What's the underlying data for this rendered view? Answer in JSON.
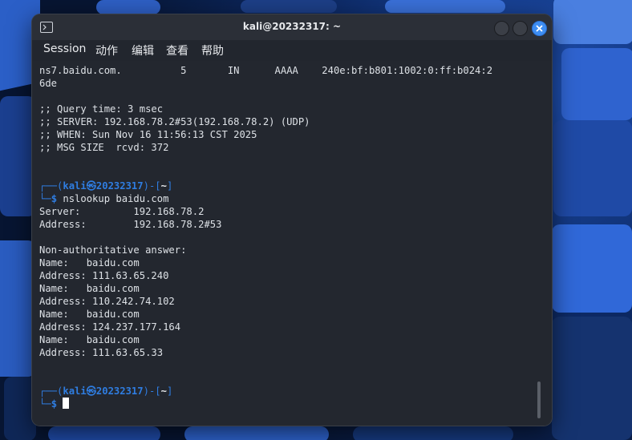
{
  "window": {
    "title": "kali@20232317: ~"
  },
  "menu": {
    "items": [
      "Session",
      "动作",
      "编辑",
      "查看",
      "帮助"
    ]
  },
  "terminal": {
    "dns_answer": {
      "name": "ns7.baidu.com.",
      "ttl": "5",
      "class": "IN",
      "type": "AAAA",
      "addr1": "240e:bf:b801:1002:0:ff:b024:2",
      "addr2": "6de"
    },
    "stats": [
      ";; Query time: 3 msec",
      ";; SERVER: 192.168.78.2#53(192.168.78.2) (UDP)",
      ";; WHEN: Sun Nov 16 11:56:13 CST 2025",
      ";; MSG SIZE  rcvd: 372"
    ],
    "prompt": {
      "user": "kali",
      "at": "㉿",
      "host": "20232317",
      "dir": "~",
      "dollar": "$"
    },
    "command": "nslookup baidu.com",
    "output": [
      "Server:         192.168.78.2",
      "Address:        192.168.78.2#53",
      "",
      "Non-authoritative answer:",
      "Name:   baidu.com",
      "Address: 111.63.65.240",
      "Name:   baidu.com",
      "Address: 110.242.74.102",
      "Name:   baidu.com",
      "Address: 124.237.177.164",
      "Name:   baidu.com",
      "Address: 111.63.65.33"
    ]
  },
  "colors": {
    "accent": "#2f7de1",
    "terminal_bg": "#23272f",
    "close_button": "#3d8df2"
  },
  "icons": {
    "title": "terminal-icon",
    "close": "close-icon"
  }
}
